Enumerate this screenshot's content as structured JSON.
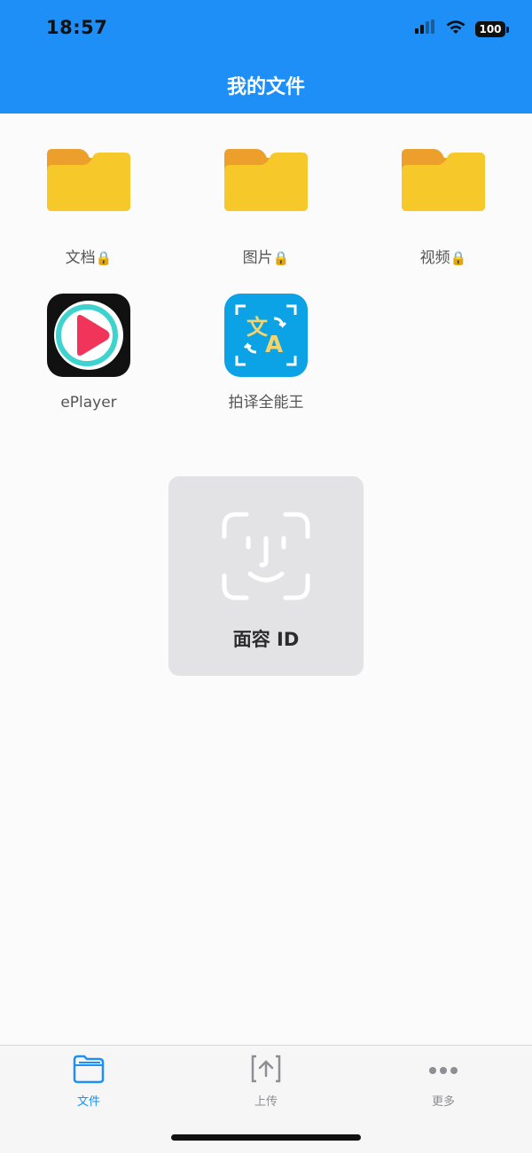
{
  "status_bar": {
    "time": "18:57",
    "battery": "100"
  },
  "header": {
    "title": "我的文件"
  },
  "items": [
    {
      "type": "folder",
      "label": "文档",
      "locked": true,
      "lock_glyph": "🔒"
    },
    {
      "type": "folder",
      "label": "图片",
      "locked": true,
      "lock_glyph": "🔒"
    },
    {
      "type": "folder",
      "label": "视频",
      "locked": true,
      "lock_glyph": "🔒"
    },
    {
      "type": "app",
      "label": "ePlayer",
      "icon": "eplayer-app-icon"
    },
    {
      "type": "app",
      "label": "拍译全能王",
      "icon": "translate-app-icon"
    }
  ],
  "faceid": {
    "label": "面容 ID",
    "icon": "face-id-icon"
  },
  "tabbar": {
    "tabs": [
      {
        "label": "文件",
        "icon": "folder-tab-icon",
        "active": true
      },
      {
        "label": "上传",
        "icon": "upload-tab-icon",
        "active": false
      },
      {
        "label": "更多",
        "icon": "more-tab-icon",
        "active": false
      }
    ]
  },
  "colors": {
    "header_bg": "#1e8ff7",
    "accent": "#1e8ff7",
    "folder": "#f5c623",
    "folder_tab": "#ec9f2b",
    "inactive_tab": "#8e8e93"
  }
}
